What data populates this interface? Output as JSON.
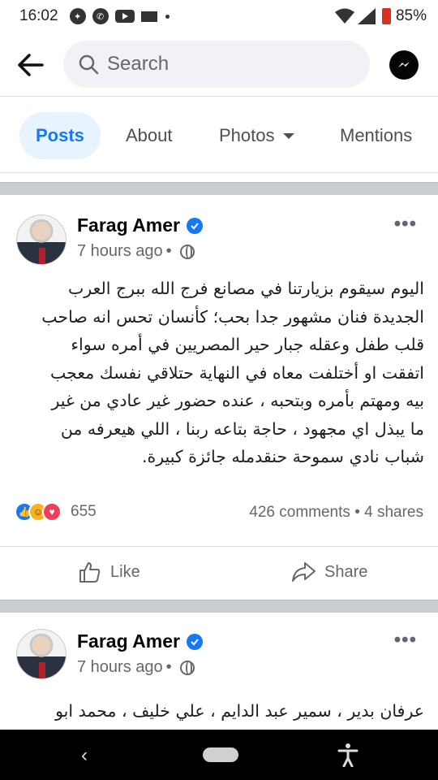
{
  "status_bar": {
    "time": "16:02",
    "battery": "85%"
  },
  "header": {
    "search_placeholder": "Search"
  },
  "tabs": [
    {
      "label": "Posts",
      "active": true
    },
    {
      "label": "About",
      "active": false
    },
    {
      "label": "Photos",
      "active": false,
      "has_dropdown": true
    },
    {
      "label": "Mentions",
      "active": false
    }
  ],
  "post1": {
    "author": "Farag Amer",
    "time": "7 hours ago",
    "text": "اليوم  سيقوم بزيارتنا  في مصانع  فرج الله ببرج العرب\nالجديدة فنان مشهور جدا بحب؛ كأنسان تحس انه صاحب\nقلب طفل وعقله جبار حير المصريين في أمره سواء\nاتفقت او أختلفت معاه في النهاية  حتلاقي  نفسك معجب\nبيه ومهتم بأمره  وبتحبه ، عنده حضور غير عادي من غير\nما يبذل اي مجهود ، حاجة بتاعه ربنا ، اللي هيعرفه من\nشباب  نادي سموحة حنقدمله  جائزة كبيرة.",
    "reaction_count": "655",
    "comments": "426 comments",
    "shares": "4 shares",
    "like_label": "Like",
    "share_label": "Share"
  },
  "post2": {
    "author": "Farag Amer",
    "time": "7 hours ago",
    "text": "عرفان بدير ، سمير عبد الدايم ، علي خليف ، محمد ابو"
  },
  "colors": {
    "accent": "#1877f2",
    "active_tab_bg": "#e7f3ff",
    "separator": "#c9ccd1"
  }
}
